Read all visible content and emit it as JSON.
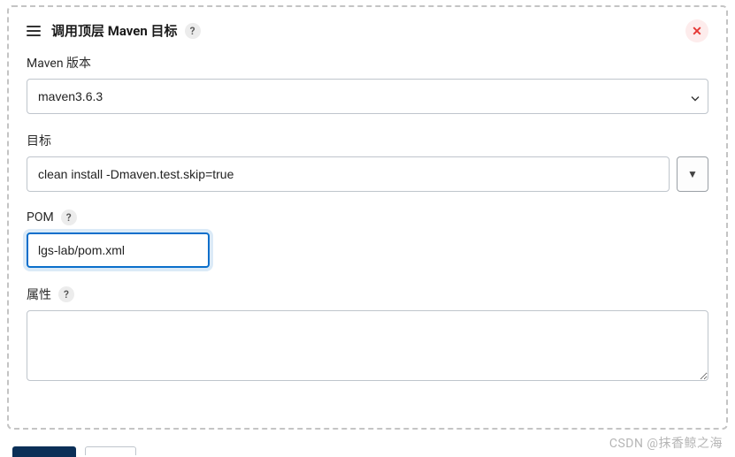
{
  "header": {
    "title": "调用顶层 Maven 目标",
    "help_glyph": "?",
    "close_glyph": "✕"
  },
  "fields": {
    "maven_version": {
      "label": "Maven 版本",
      "value": "maven3.6.3"
    },
    "goals": {
      "label": "目标",
      "value": "clean install -Dmaven.test.skip=true",
      "expand_glyph": "▼"
    },
    "pom": {
      "label": "POM",
      "help_glyph": "?",
      "value": "lgs-lab/pom.xml"
    },
    "properties": {
      "label": "属性",
      "help_glyph": "?",
      "value": ""
    }
  },
  "watermark": "CSDN @抹香鲸之海"
}
